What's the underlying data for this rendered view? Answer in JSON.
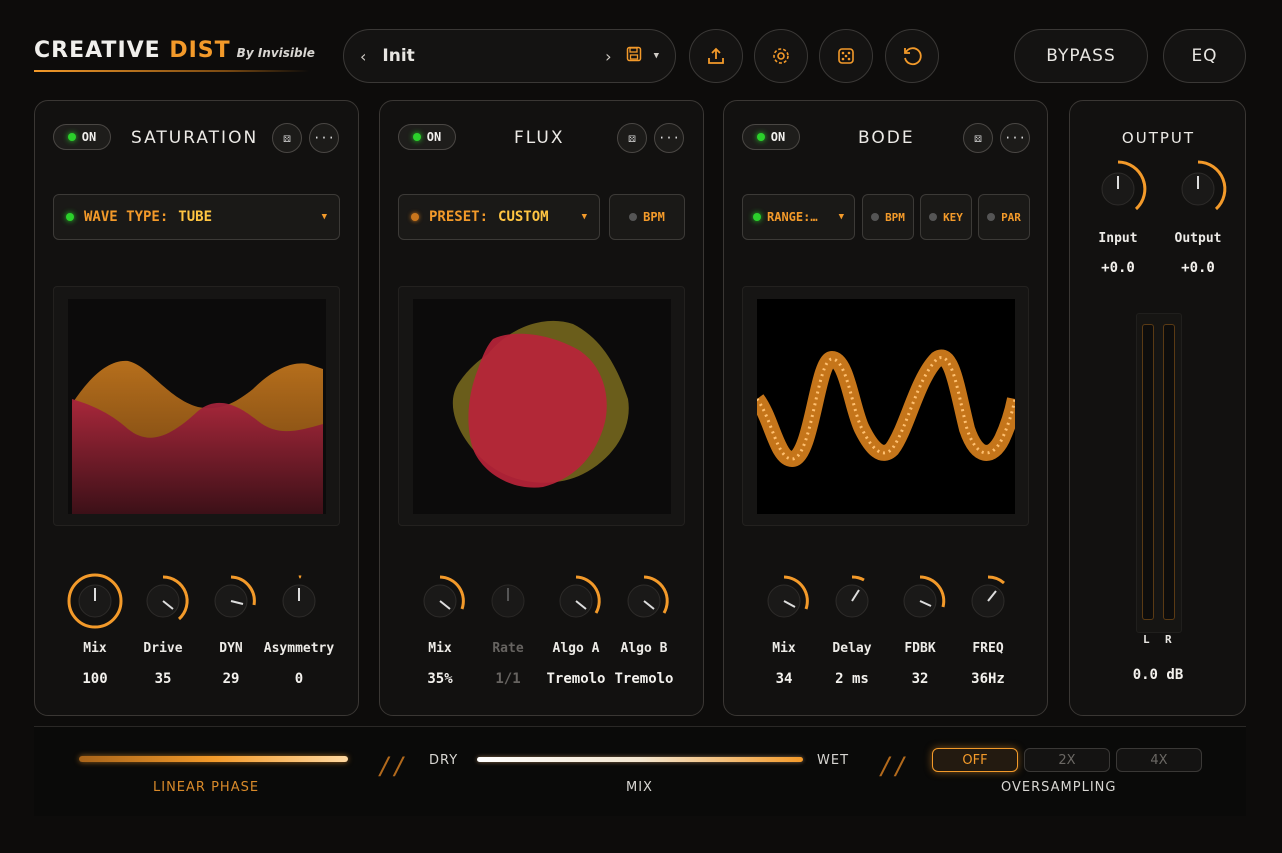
{
  "header": {
    "brand_main": "CREATIVE",
    "brand_accent": "DIST",
    "brand_by": "By Invisible",
    "preset_name": "Init",
    "bypass_label": "BYPASS",
    "eq_label": "EQ"
  },
  "saturation": {
    "toggle_label": "ON",
    "title": "SATURATION",
    "wave_type_label": "WAVE TYPE:",
    "wave_type_value": "TUBE",
    "knobs": [
      {
        "label": "Mix",
        "value": "100"
      },
      {
        "label": "Drive",
        "value": "35"
      },
      {
        "label": "DYN",
        "value": "29"
      },
      {
        "label": "Asymmetry",
        "value": "0"
      }
    ]
  },
  "flux": {
    "toggle_label": "ON",
    "title": "FLUX",
    "preset_label": "PRESET:",
    "preset_value": "CUSTOM",
    "bpm_label": "BPM",
    "knobs": [
      {
        "label": "Mix",
        "value": "35%"
      },
      {
        "label": "Rate",
        "value": "1/1"
      },
      {
        "label": "Algo A",
        "value": "Tremolo"
      },
      {
        "label": "Algo B",
        "value": "Tremolo"
      }
    ]
  },
  "bode": {
    "toggle_label": "ON",
    "title": "BODE",
    "range_label": "RANGE:…",
    "bpm_label": "BPM",
    "key_label": "KEY",
    "par_label": "PAR",
    "knobs": [
      {
        "label": "Mix",
        "value": "34"
      },
      {
        "label": "Delay",
        "value": "2 ms"
      },
      {
        "label": "FDBK",
        "value": "32"
      },
      {
        "label": "FREQ",
        "value": "36Hz"
      }
    ]
  },
  "output": {
    "title": "OUTPUT",
    "input_label": "Input",
    "input_value": "+0.0",
    "output_label": "Output",
    "output_value": "+0.0",
    "meter_left": "L",
    "meter_right": "R",
    "meter_db": "0.0 dB"
  },
  "footer": {
    "linear_phase_label": "LINEAR PHASE",
    "dry_label": "DRY",
    "wet_label": "WET",
    "mix_label": "MIX",
    "oversampling_label": "OVERSAMPLING",
    "os_options": [
      "OFF",
      "2X",
      "4X"
    ],
    "os_selected": "OFF"
  },
  "colors": {
    "accent": "#f39a2a",
    "value_yellow": "#ffc542",
    "led_green": "#2bd02b"
  }
}
